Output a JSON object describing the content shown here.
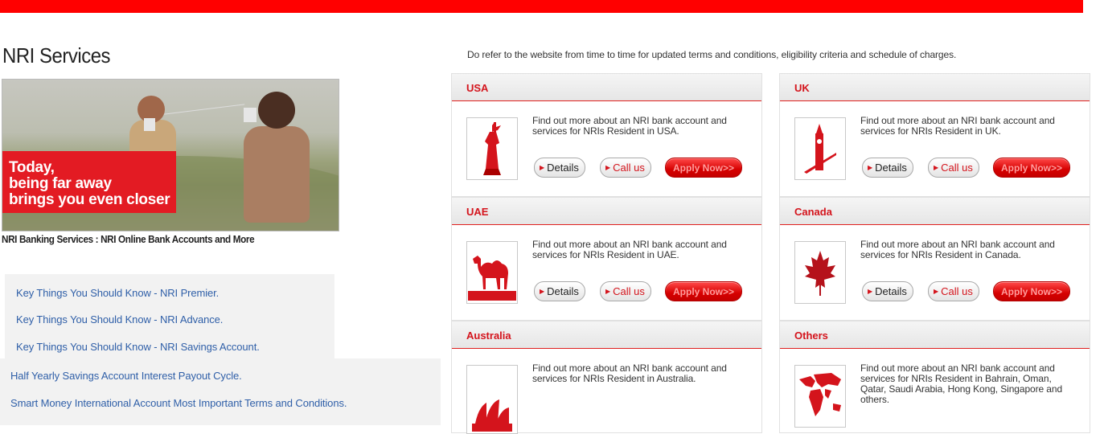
{
  "left": {
    "title": "NRI Services",
    "banner": {
      "line1": "Today,",
      "line2": "being far away",
      "line3": "brings you even closer",
      "caption": "NRI Banking Services : NRI Online Bank Accounts and More"
    },
    "links": [
      "Key Things You Should Know - NRI Premier.",
      "Key Things You Should Know - NRI Advance.",
      "Key Things You Should Know - NRI Savings Account.",
      "Half Yearly Savings Account Interest Payout Cycle.",
      "Smart Money International Account Most Important Terms and Conditions."
    ]
  },
  "right": {
    "notice": "Do refer to the website from time to time for updated terms and conditions, eligibility criteria and schedule of charges.",
    "buttons": {
      "details": "Details",
      "call": "Call us",
      "apply": "Apply Now>>"
    },
    "cards": [
      {
        "title": "USA",
        "icon": "statue-of-liberty-icon",
        "desc": "Find out more about an NRI bank account and services for NRIs Resident in USA."
      },
      {
        "title": "UK",
        "icon": "big-ben-icon",
        "desc": "Find out more about an NRI bank account and services for NRIs Resident in UK."
      },
      {
        "title": "UAE",
        "icon": "camel-icon",
        "desc": "Find out more about an NRI bank account and services for NRIs Resident in UAE."
      },
      {
        "title": "Canada",
        "icon": "maple-leaf-icon",
        "desc": "Find out more about an NRI bank account and services for NRIs Resident in Canada."
      },
      {
        "title": "Australia",
        "icon": "opera-house-icon",
        "desc": "Find out more about an NRI bank account and services for NRIs Resident in Australia."
      },
      {
        "title": "Others",
        "icon": "world-map-icon",
        "desc": "Find out more about an NRI bank account and services for NRIs Resident in Bahrain, Oman, Qatar, Saudi Arabia, Hong Kong, Singapore and others."
      }
    ],
    "colors": {
      "accent": "#d4141c",
      "topbar": "#ff0000",
      "link": "#2f5fa8"
    }
  }
}
